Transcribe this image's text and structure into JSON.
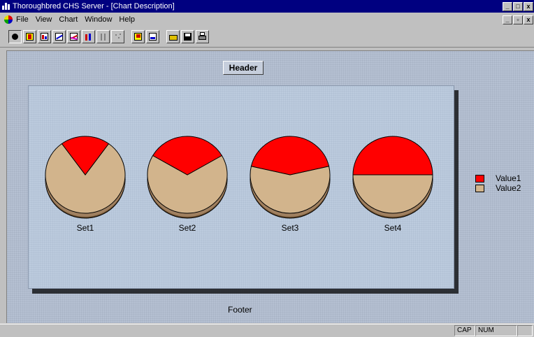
{
  "window": {
    "title": "Thoroughbred CHS Server - [Chart Description]",
    "minimize_glyph": "_",
    "maximize_glyph": "□",
    "close_glyph": "x",
    "restore_glyph": "▫"
  },
  "menu": {
    "items": [
      "File",
      "View",
      "Chart",
      "Window",
      "Help"
    ]
  },
  "toolbar": {
    "buttons": [
      "pie-chart-icon",
      "text-icon",
      "bar-chart-icon",
      "line-chart-icon",
      "area-chart-icon",
      "column-chart-icon",
      "stacked-chart-icon",
      "scatter-chart-icon",
      "edit-icon",
      "layout-icon",
      "open-folder-icon",
      "save-icon",
      "print-icon"
    ]
  },
  "chart": {
    "header": "Header",
    "footer": "Footer",
    "colors": {
      "Value1": "#ff0000",
      "Value2": "#d2b48c"
    }
  },
  "chart_data": {
    "type": "pie",
    "categories": [
      "Set1",
      "Set2",
      "Set3",
      "Set4"
    ],
    "series": [
      {
        "name": "Value1",
        "values": [
          1,
          2,
          3,
          4
        ]
      },
      {
        "name": "Value2",
        "values": [
          4,
          4,
          4,
          4
        ]
      }
    ],
    "title": "Header",
    "footer": "Footer",
    "legend_position": "right"
  },
  "status": {
    "cap": "CAP",
    "num": "NUM"
  }
}
